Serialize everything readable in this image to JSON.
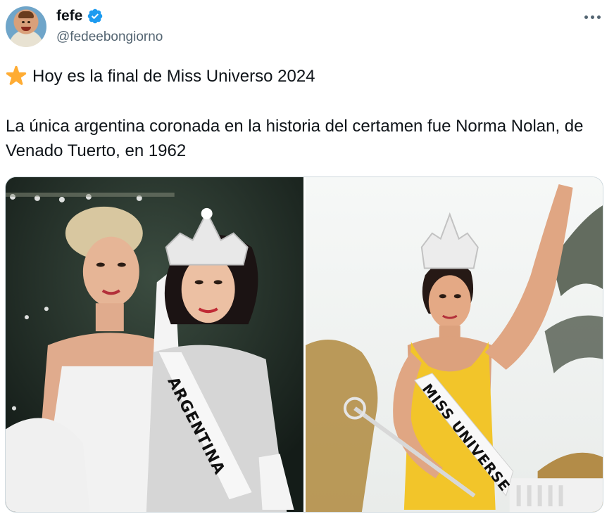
{
  "author": {
    "display_name": "fefe",
    "handle": "@fedeebongiorno",
    "verified": true
  },
  "tweet": {
    "line1": "Hoy es la final de Miss Universo 2024",
    "line2": "La única argentina coronada en la historia del certamen fue Norma Nolan, de Venado Tuerto, en 1962"
  },
  "media": {
    "left_sash_text": "ARGENTINA",
    "right_sash_text": "MISS UNIVERSE"
  },
  "icons": {
    "star": "star-emoji-icon",
    "verified": "verified-badge-icon",
    "more": "more-options-icon"
  },
  "colors": {
    "verified_blue": "#1d9bf0",
    "text_primary": "#0f1419",
    "text_secondary": "#536471",
    "star_gold": "#ffac33"
  }
}
